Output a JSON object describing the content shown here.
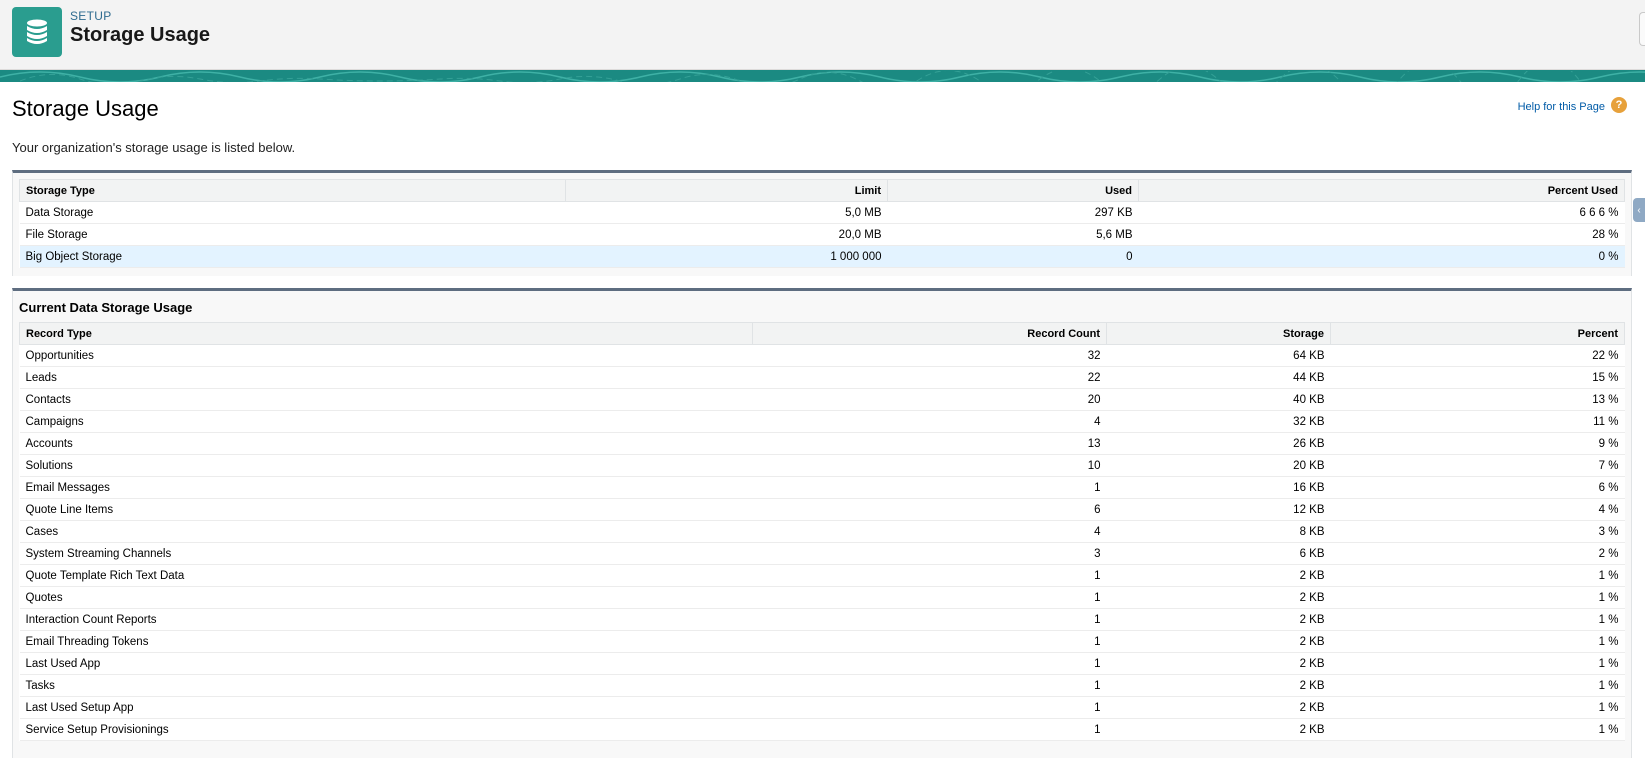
{
  "header": {
    "breadcrumb": "SETUP",
    "title": "Storage Usage",
    "icon": "database-icon"
  },
  "page": {
    "title": "Storage Usage",
    "help_label": "Help for this Page",
    "description": "Your organization's storage usage is listed below."
  },
  "storage_table": {
    "headers": [
      "Storage Type",
      "Limit",
      "Used",
      "Percent Used"
    ],
    "rows": [
      [
        "Data Storage",
        "5,0 MB",
        "297 KB",
        "6 6 6 %"
      ],
      [
        "File Storage",
        "20,0 MB",
        "5,6 MB",
        "28 %"
      ],
      [
        "Big Object Storage",
        "1 000 000",
        "0",
        "0 %"
      ]
    ]
  },
  "data_usage": {
    "title": "Current Data Storage Usage",
    "headers": [
      "Record Type",
      "Record Count",
      "Storage",
      "Percent"
    ],
    "rows": [
      [
        "Opportunities",
        "32",
        "64 KB",
        "22 %"
      ],
      [
        "Leads",
        "22",
        "44 KB",
        "15 %"
      ],
      [
        "Contacts",
        "20",
        "40 KB",
        "13 %"
      ],
      [
        "Campaigns",
        "4",
        "32 KB",
        "11 %"
      ],
      [
        "Accounts",
        "13",
        "26 KB",
        "9 %"
      ],
      [
        "Solutions",
        "10",
        "20 KB",
        "7 %"
      ],
      [
        "Email Messages",
        "1",
        "16 KB",
        "6 %"
      ],
      [
        "Quote Line Items",
        "6",
        "12 KB",
        "4 %"
      ],
      [
        "Cases",
        "4",
        "8 KB",
        "3 %"
      ],
      [
        "System Streaming Channels",
        "3",
        "6 KB",
        "2 %"
      ],
      [
        "Quote Template Rich Text Data",
        "1",
        "2 KB",
        "1 %"
      ],
      [
        "Quotes",
        "1",
        "2 KB",
        "1 %"
      ],
      [
        "Interaction Count Reports",
        "1",
        "2 KB",
        "1 %"
      ],
      [
        "Email Threading Tokens",
        "1",
        "2 KB",
        "1 %"
      ],
      [
        "Last Used App",
        "1",
        "2 KB",
        "1 %"
      ],
      [
        "Tasks",
        "1",
        "2 KB",
        "1 %"
      ],
      [
        "Last Used Setup App",
        "1",
        "2 KB",
        "1 %"
      ],
      [
        "Service Setup Provisionings",
        "1",
        "2 KB",
        "1 %"
      ]
    ]
  },
  "colors": {
    "brand_teal": "#2a9d8f",
    "banner": "#1b8a82",
    "link": "#015ba7",
    "help_icon": "#e7a13b",
    "highlight_row": "#e3f3ff"
  }
}
